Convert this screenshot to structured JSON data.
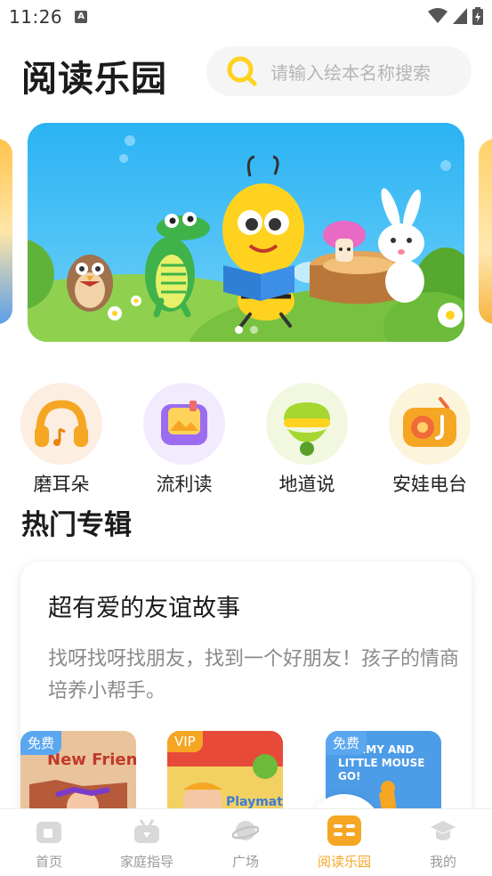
{
  "status_bar": {
    "time": "11:26",
    "app_badge": "A"
  },
  "header": {
    "title": "阅读乐园",
    "search_placeholder": "请输入绘本名称搜索"
  },
  "banner": {
    "active_index": 0,
    "total": 2
  },
  "quick_entries": [
    {
      "label": "磨耳朵",
      "icon": "headphones-icon",
      "color": "#f5a623"
    },
    {
      "label": "流利读",
      "icon": "picture-book-icon",
      "color": "#9b6cf0"
    },
    {
      "label": "地道说",
      "icon": "lollipop-icon",
      "color": "#a6d630"
    },
    {
      "label": "安娃电台",
      "icon": "radio-icon",
      "color": "#f5a623"
    }
  ],
  "section": {
    "title": "热门专辑"
  },
  "album": {
    "title": "超有爱的友谊故事",
    "description": "找呀找呀找朋友，找到一个好朋友！孩子的情商培养小帮手。",
    "books": [
      {
        "tag": "免费",
        "cover_text": "New Friend"
      },
      {
        "tag": "VIP",
        "cover_text": "Playmate"
      },
      {
        "tag": "免费",
        "cover_text": "HAMMY AND LITTLE MOUSE GO!"
      }
    ]
  },
  "bottom_nav": {
    "items": [
      {
        "label": "首页",
        "icon": "home-icon"
      },
      {
        "label": "家庭指导",
        "icon": "family-guide-icon"
      },
      {
        "label": "广场",
        "icon": "planet-icon"
      },
      {
        "label": "阅读乐园",
        "icon": "reading-book-icon"
      },
      {
        "label": "我的",
        "icon": "graduation-cap-icon"
      }
    ],
    "active": "阅读乐园"
  },
  "colors": {
    "accent": "#f5a623",
    "inactive": "#9a9a9a",
    "search_bg": "#f5f5f5"
  }
}
